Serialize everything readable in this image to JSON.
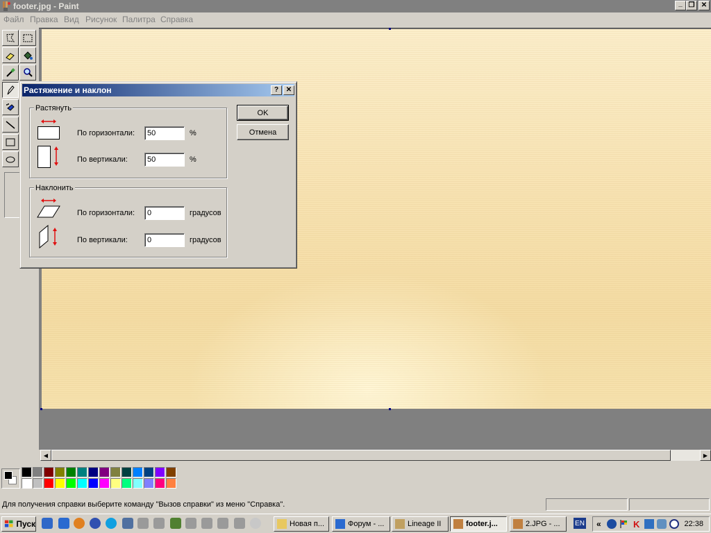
{
  "window": {
    "title": "footer.jpg - Paint",
    "controls": {
      "minimize": "_",
      "restore": "❐",
      "close": "✕"
    }
  },
  "menu": [
    "Файл",
    "Правка",
    "Вид",
    "Рисунок",
    "Палитра",
    "Справка"
  ],
  "dialog": {
    "title": "Растяжение и наклон",
    "help_button": "?",
    "close_button": "✕",
    "stretch": {
      "group_label": "Растянуть",
      "horizontal_label": "По горизонтали:",
      "horizontal_value": "50",
      "horizontal_unit": "%",
      "vertical_label": "По вертикали:",
      "vertical_value": "50",
      "vertical_unit": "%"
    },
    "skew": {
      "group_label": "Наклонить",
      "horizontal_label": "По горизонтали:",
      "horizontal_value": "0",
      "horizontal_unit": "градусов",
      "vertical_label": "По вертикали:",
      "vertical_value": "0",
      "vertical_unit": "градусов"
    },
    "ok_label": "OK",
    "cancel_label": "Отмена"
  },
  "palette": {
    "top_row": [
      "#000000",
      "#808080",
      "#800000",
      "#808000",
      "#008000",
      "#008080",
      "#000080",
      "#800080",
      "#808040",
      "#004040",
      "#0080ff",
      "#004080",
      "#8000ff",
      "#804000"
    ],
    "bottom_row": [
      "#ffffff",
      "#c0c0c0",
      "#ff0000",
      "#ffff00",
      "#00ff00",
      "#00ffff",
      "#0000ff",
      "#ff00ff",
      "#ffff80",
      "#00ff80",
      "#80ffff",
      "#8080ff",
      "#ff0080",
      "#ff8040"
    ],
    "foreground": "#000000",
    "background": "#ffffff"
  },
  "status": {
    "text": "Для получения справки выберите команду \"Вызов справки\" из меню \"Справка\"."
  },
  "taskbar": {
    "start_label": "Пуск",
    "quick_launch": [
      "browser-icon",
      "ie-icon",
      "firefox-icon",
      "player-icon",
      "skype-icon",
      "app-icon",
      "drive-icon",
      "drive-icon",
      "minecraft-icon",
      "drive-icon",
      "drive-icon",
      "drive-icon",
      "drive-icon",
      "cd-icon"
    ],
    "tasks": [
      {
        "label": "Новая п...",
        "icon": "folder-icon",
        "active": false
      },
      {
        "label": "Форум - ...",
        "icon": "ie-icon",
        "active": false
      },
      {
        "label": "Lineage II",
        "icon": "game-icon",
        "active": false
      },
      {
        "label": "footer.j...",
        "icon": "paint-icon",
        "active": true
      },
      {
        "label": "2.JPG - ...",
        "icon": "paint-icon",
        "active": false
      }
    ],
    "language": "EN",
    "tray_expand": "«",
    "clock": "22:38"
  },
  "colors": {
    "dialog_title_start": "#0a246a",
    "dialog_title_end": "#a6caf0",
    "workspace": "#808080",
    "face": "#d4d0c8"
  }
}
